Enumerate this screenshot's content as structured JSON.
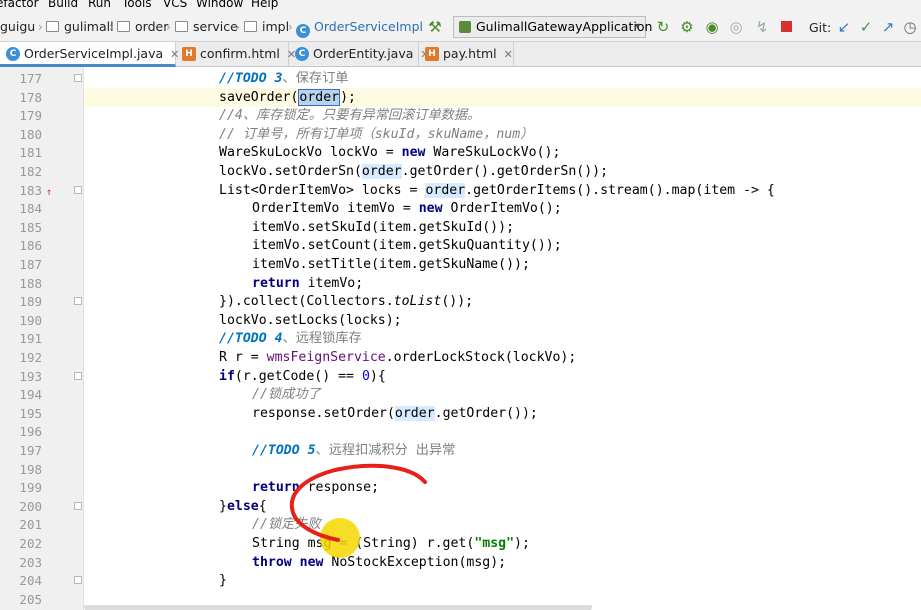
{
  "menubar": [
    "efactor",
    "Build",
    "Run",
    "Tools",
    "VCS",
    "Window",
    "Help"
  ],
  "breadcrumbs": [
    "guigu",
    "gulimall",
    "order",
    "service",
    "impl",
    "OrderServiceImpl"
  ],
  "run_config": "GulimallGatewayApplication",
  "git_label": "Git:",
  "tabs": [
    {
      "label": "OrderServiceImpl.java",
      "icon": "class-icon",
      "active": true
    },
    {
      "label": "confirm.html",
      "icon": "html-icon",
      "active": false
    },
    {
      "label": "OrderEntity.java",
      "icon": "class-icon",
      "active": false
    },
    {
      "label": "pay.html",
      "icon": "html-icon",
      "active": false
    }
  ],
  "editor": {
    "current_line": "178",
    "lines": [
      {
        "n": "177",
        "segs": [
          [
            "todo",
            "//TODO 3"
          ],
          [
            "cmzh",
            "、保存订单"
          ]
        ]
      },
      {
        "n": "178",
        "segs": [
          [
            "",
            "saveOrder("
          ],
          [
            "sel",
            "order"
          ],
          [
            "",
            ");"
          ]
        ]
      },
      {
        "n": "179",
        "segs": [
          [
            "cm",
            "//4、库存锁定。只要有异常回滚订单数据。"
          ]
        ]
      },
      {
        "n": "180",
        "segs": [
          [
            "cm",
            "// 订单号，所有订单项（skuId，skuName，num）"
          ]
        ]
      },
      {
        "n": "181",
        "segs": [
          [
            "",
            "WareSkuLockVo lockVo = "
          ],
          [
            "kw",
            "new"
          ],
          [
            "",
            " WareSkuLockVo();"
          ]
        ]
      },
      {
        "n": "182",
        "segs": [
          [
            "",
            "lockVo.setOrderSn("
          ],
          [
            "hl",
            "order"
          ],
          [
            "",
            ".getOrder().getOrderSn());"
          ]
        ]
      },
      {
        "n": "183",
        "segs": [
          [
            "",
            "List<OrderItemVo> locks = "
          ],
          [
            "hl",
            "order"
          ],
          [
            "",
            ".getOrderItems().stream().map(item -> {"
          ]
        ]
      },
      {
        "n": "184",
        "indent": 1,
        "segs": [
          [
            "",
            "OrderItemVo itemVo = "
          ],
          [
            "kw",
            "new"
          ],
          [
            "",
            " OrderItemVo();"
          ]
        ]
      },
      {
        "n": "185",
        "indent": 1,
        "segs": [
          [
            "",
            "itemVo.setSkuId(item.getSkuId());"
          ]
        ]
      },
      {
        "n": "186",
        "indent": 1,
        "segs": [
          [
            "",
            "itemVo.setCount(item.getSkuQuantity());"
          ]
        ]
      },
      {
        "n": "187",
        "indent": 1,
        "segs": [
          [
            "",
            "itemVo.setTitle(item.getSkuName());"
          ]
        ]
      },
      {
        "n": "188",
        "indent": 1,
        "segs": [
          [
            "kw",
            "return"
          ],
          [
            "",
            " itemVo;"
          ]
        ]
      },
      {
        "n": "189",
        "segs": [
          [
            "",
            "}).collect(Collectors."
          ],
          [
            "it",
            "toList"
          ],
          [
            "",
            "());"
          ]
        ]
      },
      {
        "n": "190",
        "segs": [
          [
            "",
            "lockVo.setLocks(locks);"
          ]
        ]
      },
      {
        "n": "191",
        "segs": [
          [
            "todo",
            "//TODO 4"
          ],
          [
            "cmzh",
            "、远程锁库存"
          ]
        ]
      },
      {
        "n": "192",
        "segs": [
          [
            "",
            "R r = "
          ],
          [
            "fld",
            "wmsFeignService"
          ],
          [
            "",
            ".orderLockStock(lockVo);"
          ]
        ]
      },
      {
        "n": "193",
        "segs": [
          [
            "kw",
            "if"
          ],
          [
            "",
            "(r.getCode() == "
          ],
          [
            "num",
            "0"
          ],
          [
            "",
            "){"
          ]
        ]
      },
      {
        "n": "194",
        "indent": 1,
        "segs": [
          [
            "cm",
            "//锁成功了"
          ]
        ]
      },
      {
        "n": "195",
        "indent": 1,
        "segs": [
          [
            "",
            "response.setOrder("
          ],
          [
            "hl",
            "order"
          ],
          [
            "",
            ".getOrder());"
          ]
        ]
      },
      {
        "n": "196",
        "segs": []
      },
      {
        "n": "197",
        "indent": 1,
        "segs": [
          [
            "todo",
            "//TODO 5"
          ],
          [
            "cmzh",
            "、远程扣减积分 出异常"
          ]
        ]
      },
      {
        "n": "198",
        "segs": []
      },
      {
        "n": "199",
        "indent": 1,
        "segs": [
          [
            "kw",
            "return"
          ],
          [
            "",
            " response;"
          ]
        ]
      },
      {
        "n": "200",
        "segs": [
          [
            "",
            "}"
          ],
          [
            "kw",
            "else"
          ],
          [
            "",
            "{"
          ]
        ]
      },
      {
        "n": "201",
        "indent": 1,
        "segs": [
          [
            "cm",
            "//锁定失败"
          ]
        ]
      },
      {
        "n": "202",
        "indent": 1,
        "segs": [
          [
            "",
            "String msg = (String) r.get("
          ],
          [
            "str",
            "\"msg\""
          ],
          [
            "",
            ");"
          ]
        ]
      },
      {
        "n": "203",
        "indent": 1,
        "segs": [
          [
            "kw",
            "throw"
          ],
          [
            "",
            " "
          ],
          [
            "kw",
            "new"
          ],
          [
            "",
            " NoStockException(msg);"
          ]
        ]
      },
      {
        "n": "204",
        "segs": [
          [
            "",
            "}"
          ]
        ]
      },
      {
        "n": "205",
        "segs": []
      }
    ]
  },
  "colors": {
    "todo": "#0073bf",
    "keyword": "#000080",
    "comment": "#808080",
    "string": "#008000",
    "number": "#0000ff",
    "field": "#660e7a",
    "annotation_stroke": "#e8201a",
    "cursor_highlight": "#f5d800"
  }
}
